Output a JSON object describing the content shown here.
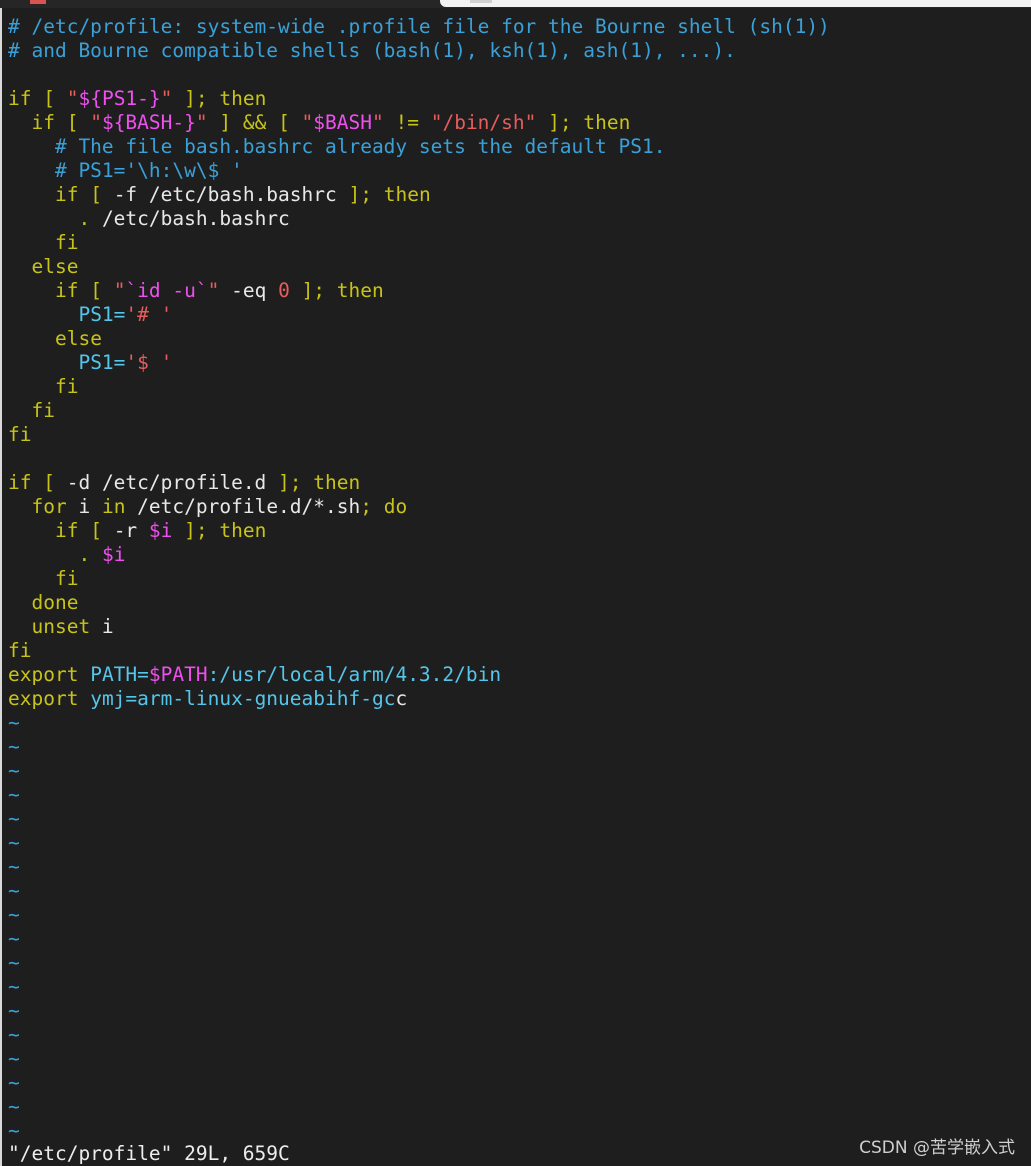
{
  "colors": {
    "background": "#1e1e1e",
    "comment": "#3aa1d8",
    "keyword": "#c7c318",
    "string": "#e85c5c",
    "variable": "#ef4fef",
    "identifier": "#55c6ea"
  },
  "editor": {
    "lines": [
      [
        {
          "t": "# /etc/profile: system-wide .profile file for the Bourne shell (sh(1))",
          "c": "comment"
        }
      ],
      [
        {
          "t": "# and Bourne compatible shells (bash(1), ksh(1), ash(1), ...).",
          "c": "comment"
        }
      ],
      [],
      [
        {
          "t": "if",
          "c": "kw"
        },
        {
          "t": " [ ",
          "c": "br"
        },
        {
          "t": "\"",
          "c": "str"
        },
        {
          "t": "${PS1-}",
          "c": "var"
        },
        {
          "t": "\"",
          "c": "str"
        },
        {
          "t": " ]; ",
          "c": "br"
        },
        {
          "t": "then",
          "c": "kw"
        }
      ],
      [
        {
          "t": "  "
        },
        {
          "t": "if",
          "c": "kw"
        },
        {
          "t": " [ ",
          "c": "br"
        },
        {
          "t": "\"",
          "c": "str"
        },
        {
          "t": "${BASH-}",
          "c": "var"
        },
        {
          "t": "\"",
          "c": "str"
        },
        {
          "t": " ] && [ ",
          "c": "br"
        },
        {
          "t": "\"",
          "c": "str"
        },
        {
          "t": "$BASH",
          "c": "var"
        },
        {
          "t": "\"",
          "c": "str"
        },
        {
          "t": " != ",
          "c": "br"
        },
        {
          "t": "\"/bin/sh\"",
          "c": "str"
        },
        {
          "t": " ]; ",
          "c": "br"
        },
        {
          "t": "then",
          "c": "kw"
        }
      ],
      [
        {
          "t": "    # The file bash.bashrc already sets the default PS1.",
          "c": "comment"
        }
      ],
      [
        {
          "t": "    # PS1='\\h:\\w\\$ '",
          "c": "comment"
        }
      ],
      [
        {
          "t": "    "
        },
        {
          "t": "if",
          "c": "kw"
        },
        {
          "t": " [ ",
          "c": "br"
        },
        {
          "t": "-f /etc/bash.bashrc"
        },
        {
          "t": " ]; ",
          "c": "br"
        },
        {
          "t": "then",
          "c": "kw"
        }
      ],
      [
        {
          "t": "      "
        },
        {
          "t": ".",
          "c": "kw"
        },
        {
          "t": " /etc/bash.bashrc"
        }
      ],
      [
        {
          "t": "    "
        },
        {
          "t": "fi",
          "c": "kw"
        }
      ],
      [
        {
          "t": "  "
        },
        {
          "t": "else",
          "c": "kw"
        }
      ],
      [
        {
          "t": "    "
        },
        {
          "t": "if",
          "c": "kw"
        },
        {
          "t": " [ ",
          "c": "br"
        },
        {
          "t": "\"",
          "c": "str"
        },
        {
          "t": "`id -u`",
          "c": "var"
        },
        {
          "t": "\"",
          "c": "str"
        },
        {
          "t": " -eq "
        },
        {
          "t": "0",
          "c": "num"
        },
        {
          "t": " ]; ",
          "c": "br"
        },
        {
          "t": "then",
          "c": "kw"
        }
      ],
      [
        {
          "t": "      "
        },
        {
          "t": "PS1=",
          "c": "id"
        },
        {
          "t": "'# '",
          "c": "str"
        }
      ],
      [
        {
          "t": "    "
        },
        {
          "t": "else",
          "c": "kw"
        }
      ],
      [
        {
          "t": "      "
        },
        {
          "t": "PS1=",
          "c": "id"
        },
        {
          "t": "'$ '",
          "c": "str"
        }
      ],
      [
        {
          "t": "    "
        },
        {
          "t": "fi",
          "c": "kw"
        }
      ],
      [
        {
          "t": "  "
        },
        {
          "t": "fi",
          "c": "kw"
        }
      ],
      [
        {
          "t": "fi",
          "c": "kw"
        }
      ],
      [],
      [
        {
          "t": "if",
          "c": "kw"
        },
        {
          "t": " [ ",
          "c": "br"
        },
        {
          "t": "-d /etc/profile.d"
        },
        {
          "t": " ]; ",
          "c": "br"
        },
        {
          "t": "then",
          "c": "kw"
        }
      ],
      [
        {
          "t": "  "
        },
        {
          "t": "for",
          "c": "kw"
        },
        {
          "t": " i "
        },
        {
          "t": "in",
          "c": "kw"
        },
        {
          "t": " /etc/profile.d/*.sh"
        },
        {
          "t": "; ",
          "c": "br"
        },
        {
          "t": "do",
          "c": "kw"
        }
      ],
      [
        {
          "t": "    "
        },
        {
          "t": "if",
          "c": "kw"
        },
        {
          "t": " [ ",
          "c": "br"
        },
        {
          "t": "-r "
        },
        {
          "t": "$i",
          "c": "var"
        },
        {
          "t": " ]; ",
          "c": "br"
        },
        {
          "t": "then",
          "c": "kw"
        }
      ],
      [
        {
          "t": "      "
        },
        {
          "t": ".",
          "c": "kw"
        },
        {
          "t": " "
        },
        {
          "t": "$i",
          "c": "var"
        }
      ],
      [
        {
          "t": "    "
        },
        {
          "t": "fi",
          "c": "kw"
        }
      ],
      [
        {
          "t": "  "
        },
        {
          "t": "done",
          "c": "kw"
        }
      ],
      [
        {
          "t": "  "
        },
        {
          "t": "unset",
          "c": "kw"
        },
        {
          "t": " i"
        }
      ],
      [
        {
          "t": "fi",
          "c": "kw"
        }
      ],
      [
        {
          "t": "export",
          "c": "kw"
        },
        {
          "t": " "
        },
        {
          "t": "PATH=",
          "c": "id"
        },
        {
          "t": "$PATH",
          "c": "var"
        },
        {
          "t": ":/usr/local/arm/4.3.2/bin",
          "c": "id"
        }
      ],
      [
        {
          "t": "export",
          "c": "kw"
        },
        {
          "t": " "
        },
        {
          "t": "ymj=arm-linux-gnueabihf-gc",
          "c": "id"
        },
        {
          "t": "c",
          "c": "cursor"
        }
      ],
      [
        {
          "t": "~",
          "c": "tilde"
        }
      ],
      [
        {
          "t": "~",
          "c": "tilde"
        }
      ],
      [
        {
          "t": "~",
          "c": "tilde"
        }
      ],
      [
        {
          "t": "~",
          "c": "tilde"
        }
      ],
      [
        {
          "t": "~",
          "c": "tilde"
        }
      ],
      [
        {
          "t": "~",
          "c": "tilde"
        }
      ],
      [
        {
          "t": "~",
          "c": "tilde"
        }
      ],
      [
        {
          "t": "~",
          "c": "tilde"
        }
      ],
      [
        {
          "t": "~",
          "c": "tilde"
        }
      ],
      [
        {
          "t": "~",
          "c": "tilde"
        }
      ],
      [
        {
          "t": "~",
          "c": "tilde"
        }
      ],
      [
        {
          "t": "~",
          "c": "tilde"
        }
      ],
      [
        {
          "t": "~",
          "c": "tilde"
        }
      ],
      [
        {
          "t": "~",
          "c": "tilde"
        }
      ],
      [
        {
          "t": "~",
          "c": "tilde"
        }
      ],
      [
        {
          "t": "~",
          "c": "tilde"
        }
      ],
      [
        {
          "t": "~",
          "c": "tilde"
        }
      ],
      [
        {
          "t": "~",
          "c": "tilde"
        }
      ]
    ]
  },
  "status_line": "\"/etc/profile\" 29L, 659C",
  "watermark": "CSDN @苦学嵌入式"
}
